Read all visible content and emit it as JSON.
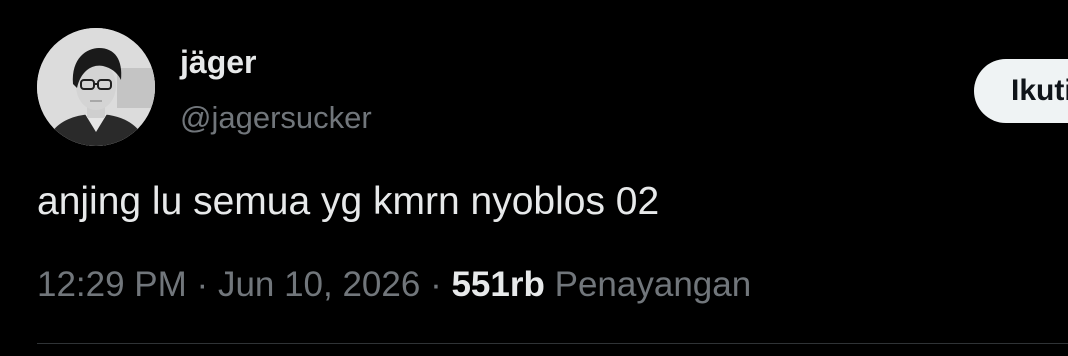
{
  "tweet": {
    "author": {
      "display_name": "jäger",
      "handle": "@jagersucker",
      "avatar": "avatar-photo"
    },
    "follow_label": "Ikuti",
    "text": "anjing lu semua yg kmrn nyoblos 02",
    "time": "12:29 PM",
    "separator": "·",
    "date": "Jun 10, 2026",
    "views_count": "551rb",
    "views_label": "Penayangan"
  },
  "colors": {
    "background": "#000000",
    "primary_text": "#e7e9ea",
    "secondary_text": "#71767b",
    "follow_button_bg": "#eff3f4",
    "divider": "#2f3336"
  }
}
